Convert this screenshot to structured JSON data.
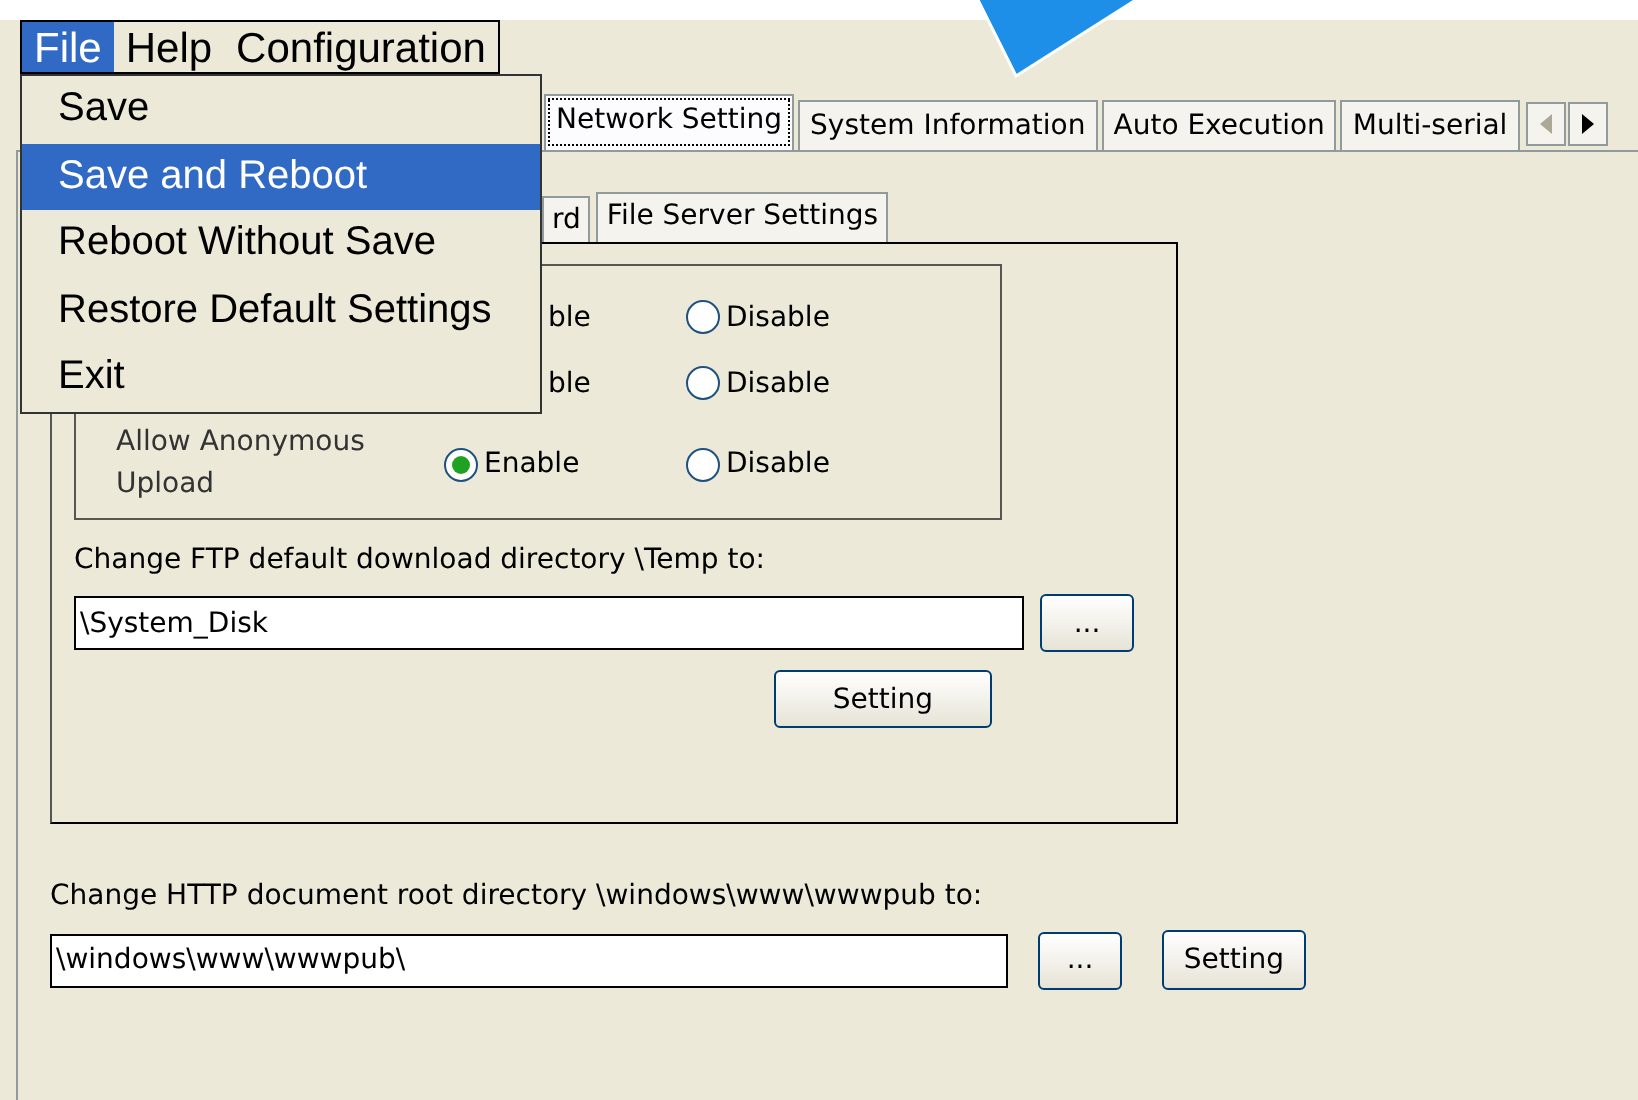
{
  "menu_bar": {
    "items": [
      {
        "label": "File",
        "selected": true
      },
      {
        "label": "Help",
        "selected": false
      },
      {
        "label": "Configuration",
        "selected": false
      }
    ]
  },
  "file_menu": {
    "items": [
      {
        "label": "Save",
        "selected": false
      },
      {
        "label": "Save and Reboot",
        "selected": true
      },
      {
        "label": "Reboot Without Save",
        "selected": false
      },
      {
        "label": "Restore Default Settings",
        "selected": false
      },
      {
        "label": "Exit",
        "selected": false
      }
    ]
  },
  "tabs": [
    {
      "label": "Network Setting",
      "selected": true
    },
    {
      "label": "System Information",
      "selected": false
    },
    {
      "label": "Auto Execution",
      "selected": false
    },
    {
      "label": "Multi-serial",
      "selected": false
    }
  ],
  "tab_scroll": {
    "left": {
      "disabled": true
    },
    "right": {
      "disabled": false
    }
  },
  "inner_tabs": [
    {
      "label": "rd",
      "selected": false
    },
    {
      "label": "File Server Settings",
      "selected": true
    }
  ],
  "ftp_options": [
    {
      "options": [
        {
          "text": "ble"
        },
        {
          "text": "Disable",
          "selected": false
        }
      ]
    },
    {
      "options": [
        {
          "text": "ble"
        },
        {
          "text": "Disable",
          "selected": false
        }
      ]
    },
    {
      "label": "Allow Anonymous Upload",
      "options": [
        {
          "text": "Enable",
          "selected": true
        },
        {
          "text": "Disable",
          "selected": false
        }
      ]
    }
  ],
  "ftp_directory": {
    "label": "Change FTP default download directory \\Temp to:",
    "value": "\\System_Disk",
    "browse": "...",
    "apply": "Setting"
  },
  "http_directory": {
    "label": "Change HTTP document root directory \\windows\\www\\wwwpub to:",
    "value": "\\windows\\www\\wwwpub\\",
    "browse": "...",
    "apply": "Setting"
  }
}
